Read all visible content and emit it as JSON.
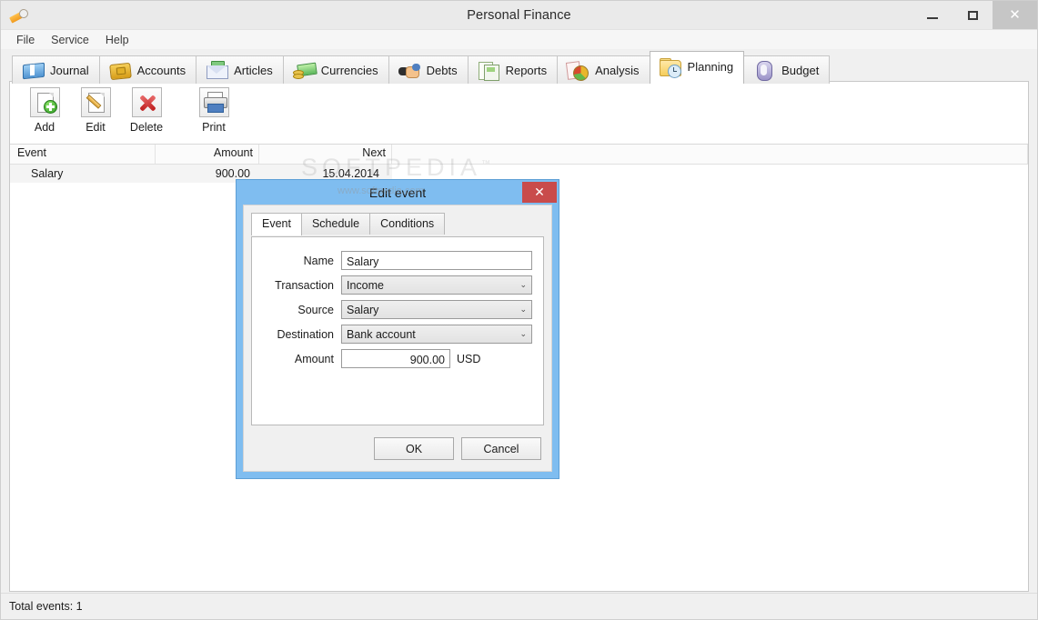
{
  "window": {
    "title": "Personal Finance",
    "icon": "pencil-icon",
    "controls": {
      "minimize": "–",
      "maximize": "☐",
      "close": "✕"
    }
  },
  "menubar": {
    "items": [
      {
        "label": "File"
      },
      {
        "label": "Service"
      },
      {
        "label": "Help"
      }
    ]
  },
  "tabs": [
    {
      "label": "Journal",
      "icon": "book-icon",
      "active": false
    },
    {
      "label": "Accounts",
      "icon": "wallet-icon",
      "active": false
    },
    {
      "label": "Articles",
      "icon": "envelope-icon",
      "active": false
    },
    {
      "label": "Currencies",
      "icon": "money-icon",
      "active": false
    },
    {
      "label": "Debts",
      "icon": "handshake-icon",
      "active": false
    },
    {
      "label": "Reports",
      "icon": "report-icon",
      "active": false
    },
    {
      "label": "Analysis",
      "icon": "piechart-icon",
      "active": false
    },
    {
      "label": "Planning",
      "icon": "folder-clock-icon",
      "active": true
    },
    {
      "label": "Budget",
      "icon": "paragraph-icon",
      "active": false
    }
  ],
  "toolbar": {
    "buttons": [
      {
        "label": "Add",
        "icon": "document-add-icon"
      },
      {
        "label": "Edit",
        "icon": "document-edit-icon"
      },
      {
        "label": "Delete",
        "icon": "red-cross-icon"
      },
      {
        "label": "Print",
        "icon": "printer-icon"
      }
    ]
  },
  "list": {
    "columns": [
      "Event",
      "Amount",
      "Next"
    ],
    "rows": [
      {
        "event": "Salary",
        "amount": "900.00",
        "next": "15.04.2014"
      }
    ]
  },
  "watermark": {
    "text": "SOFTPEDIA",
    "trademark": "™",
    "url": "www.softpedia.com"
  },
  "statusbar": {
    "text": "Total events: 1"
  },
  "dialog": {
    "title": "Edit event",
    "close_label": "✕",
    "tabs": [
      {
        "label": "Event",
        "active": true
      },
      {
        "label": "Schedule",
        "active": false
      },
      {
        "label": "Conditions",
        "active": false
      }
    ],
    "fields": {
      "name": {
        "label": "Name",
        "value": "Salary",
        "placeholder": ""
      },
      "transaction": {
        "label": "Transaction",
        "value": "Income",
        "chevron": "⌄"
      },
      "source": {
        "label": "Source",
        "value": "Salary",
        "chevron": "⌄"
      },
      "destination": {
        "label": "Destination",
        "value": "Bank account",
        "chevron": "⌄"
      },
      "amount": {
        "label": "Amount",
        "value": "900.00",
        "currency": "USD"
      }
    },
    "buttons": {
      "ok": "OK",
      "cancel": "Cancel"
    }
  },
  "colors": {
    "dialog_accent": "#7fbdf0",
    "dialog_close": "#c94b4b",
    "active_tab_bg": "#ffffff",
    "window_chrome": "#f0f0f0"
  }
}
